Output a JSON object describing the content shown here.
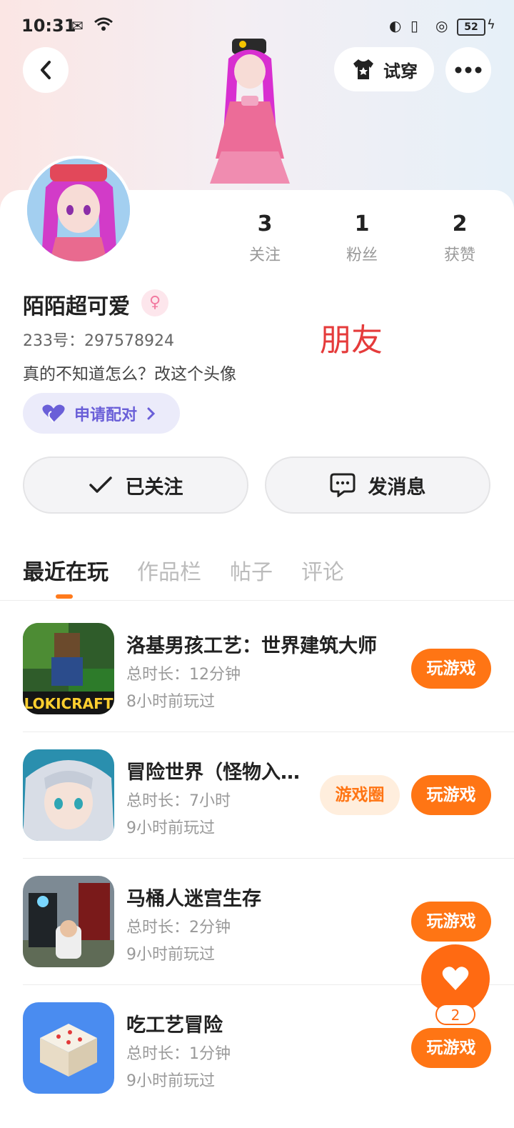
{
  "status_bar": {
    "time": "10:31",
    "battery": "52"
  },
  "header": {
    "try_on_label": "试穿"
  },
  "profile": {
    "name": "陌陌超可爱",
    "gender_symbol": "♀",
    "uid": "233号：297578924",
    "bio": "真的不知道怎么？改这个头像",
    "relation_annotation": "朋友",
    "pair_label": "申请配对",
    "stats": [
      {
        "count": "3",
        "label": "关注"
      },
      {
        "count": "1",
        "label": "粉丝"
      },
      {
        "count": "2",
        "label": "获赞"
      }
    ]
  },
  "actions": {
    "followed_label": "已关注",
    "message_label": "发消息"
  },
  "tabs": [
    "最近在玩",
    "作品栏",
    "帖子",
    "评论"
  ],
  "games": [
    {
      "title": "洛基男孩工艺：世界建筑大师",
      "duration": "总时长：12分钟",
      "last_played": "8小时前玩过",
      "play_label": "玩游戏"
    },
    {
      "title": "冒险世界（怪物入…",
      "duration": "总时长：7小时",
      "last_played": "9小时前玩过",
      "play_label": "玩游戏",
      "circle_label": "游戏圈"
    },
    {
      "title": "马桶人迷宫生存",
      "duration": "总时长：2分钟",
      "last_played": "9小时前玩过",
      "play_label": "玩游戏"
    },
    {
      "title": "吃工艺冒险",
      "duration": "总时长：1分钟",
      "last_played": "9小时前玩过",
      "play_label": "玩游戏"
    }
  ],
  "fab": {
    "badge_count": "2"
  },
  "colors": {
    "accent": "#ff7514",
    "pair_purple": "#6a5fd8",
    "annotation_red": "#e53b3b"
  }
}
